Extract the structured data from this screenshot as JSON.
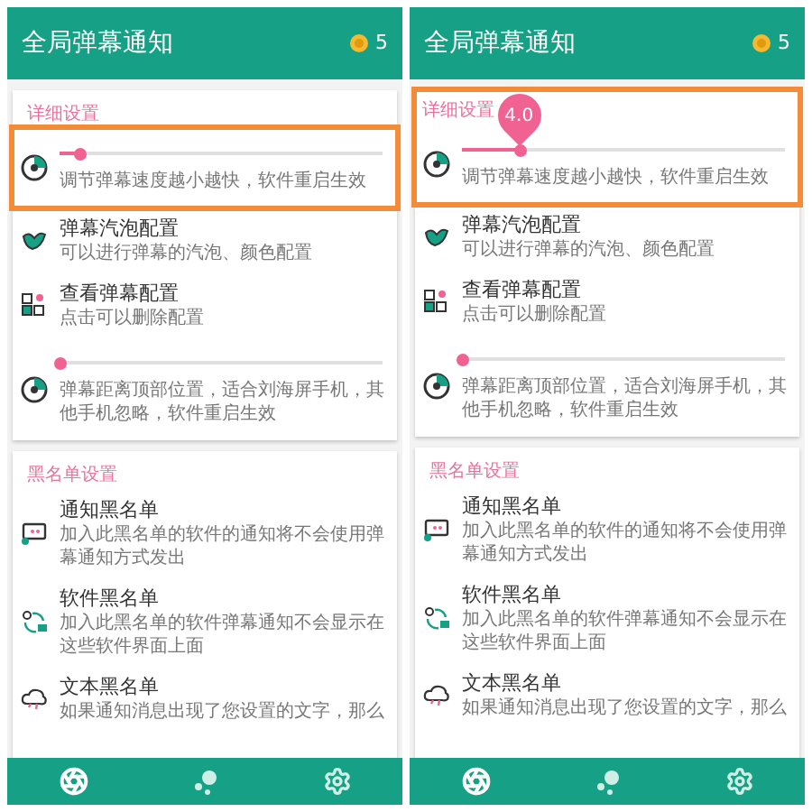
{
  "screens": [
    {
      "title": "全局弹幕通知",
      "coins": "5",
      "nav": [
        {
          "selected": true
        },
        {
          "selected": false
        },
        {
          "selected": false
        }
      ],
      "sections": [
        {
          "title": "详细设置",
          "highlighted": false,
          "items": [
            {
              "kind": "slider",
              "highlighted": true,
              "level": 0.06,
              "description": "调节弹幕速度越小越快，软件重启生效"
            },
            {
              "kind": "entry",
              "title": "弹幕汽泡配置",
              "description": "可以进行弹幕的汽泡、颜色配置"
            },
            {
              "kind": "entry",
              "title": "查看弹幕配置",
              "description": "点击可以删除配置"
            },
            {
              "kind": "slider",
              "highlighted": false,
              "level": 0,
              "description": "弹幕距离顶部位置，适合刘海屏手机，其他手机忽略，软件重启生效"
            }
          ]
        },
        {
          "title": "黑名单设置",
          "highlighted": false,
          "items": [
            {
              "kind": "entry",
              "title": "通知黑名单",
              "description": "加入此黑名单的软件的通知将不会使用弹幕通知方式发出"
            },
            {
              "kind": "entry",
              "title": "软件黑名单",
              "description": "加入此黑名单的软件弹幕通知不会显示在这些软件界面上面"
            },
            {
              "kind": "entry",
              "title": "文本黑名单",
              "description": "如果通知消息出现了您设置的文字，那么"
            }
          ]
        }
      ]
    },
    {
      "title": "全局弹幕通知",
      "coins": "5",
      "nav": [
        {
          "selected": true
        },
        {
          "selected": false
        },
        {
          "selected": false
        }
      ],
      "sections": [
        {
          "title": "详细设置",
          "highlighted": true,
          "items": [
            {
              "kind": "slider",
              "highlighted": false,
              "level": 0.18,
              "value_label": "4.0",
              "description": "调节弹幕速度越小越快，软件重启生效"
            },
            {
              "kind": "entry",
              "title": "弹幕汽泡配置",
              "description": "可以进行弹幕的汽泡、颜色配置"
            },
            {
              "kind": "entry",
              "title": "查看弹幕配置",
              "description": "点击可以删除配置"
            },
            {
              "kind": "slider",
              "highlighted": false,
              "level": 0,
              "description": "弹幕距离顶部位置，适合刘海屏手机，其他手机忽略，软件重启生效"
            }
          ]
        },
        {
          "title": "黑名单设置",
          "highlighted": false,
          "items": [
            {
              "kind": "entry",
              "title": "通知黑名单",
              "description": "加入此黑名单的软件的通知将不会使用弹幕通知方式发出"
            },
            {
              "kind": "entry",
              "title": "软件黑名单",
              "description": "加入此黑名单的软件弹幕通知不会显示在这些软件界面上面"
            },
            {
              "kind": "entry",
              "title": "文本黑名单",
              "description": "如果通知消息出现了您设置的文字，那么"
            }
          ]
        }
      ]
    }
  ]
}
